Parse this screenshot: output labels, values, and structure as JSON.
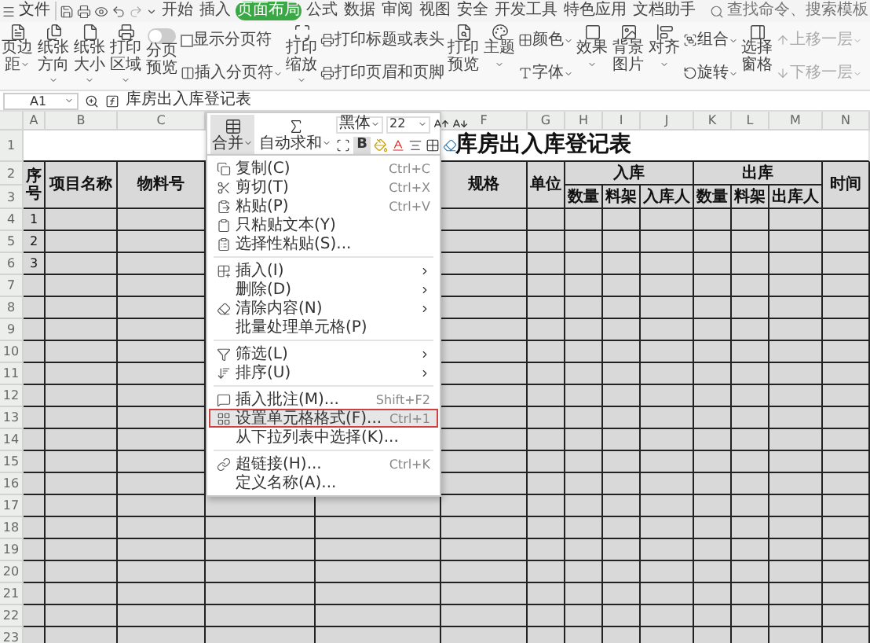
{
  "menu_button": {
    "label": "文件"
  },
  "tabs": [
    {
      "label": "开始",
      "selected": false
    },
    {
      "label": "插入",
      "selected": false
    },
    {
      "label": "页面布局",
      "selected": true
    },
    {
      "label": "公式",
      "selected": false
    },
    {
      "label": "数据",
      "selected": false
    },
    {
      "label": "审阅",
      "selected": false
    },
    {
      "label": "视图",
      "selected": false
    },
    {
      "label": "安全",
      "selected": false
    },
    {
      "label": "开发工具",
      "selected": false
    },
    {
      "label": "特色应用",
      "selected": false
    },
    {
      "label": "文档助手",
      "selected": false
    }
  ],
  "search": {
    "placeholder": "查找命令、搜索模板"
  },
  "ribbon": [
    {
      "kind": "large",
      "label": "页边距",
      "dropdown": true,
      "disabled": false
    },
    {
      "kind": "large",
      "label": "纸张方向",
      "dropdown": true,
      "disabled": false
    },
    {
      "kind": "large",
      "label": "纸张大小",
      "dropdown": true,
      "disabled": false
    },
    {
      "kind": "large",
      "label": "打印区域",
      "dropdown": true,
      "disabled": false
    },
    {
      "kind": "toggle",
      "label": "分页预览",
      "on": false
    },
    {
      "kind": "stack",
      "items": [
        {
          "kind": "checkbox",
          "label": "显示分页符",
          "checked": false
        },
        {
          "kind": "button",
          "label": "插入分页符",
          "dropdown": true,
          "disabled": false
        }
      ]
    },
    {
      "kind": "large",
      "label": "打印缩放",
      "dropdown": true,
      "disabled": false
    },
    {
      "kind": "stack",
      "items": [
        {
          "kind": "button",
          "label": "打印标题或表头",
          "dropdown": false,
          "disabled": false
        },
        {
          "kind": "button",
          "label": "打印页眉和页脚",
          "dropdown": false,
          "disabled": false
        }
      ]
    },
    {
      "kind": "large",
      "label": "打印预览",
      "dropdown": false,
      "disabled": false
    },
    {
      "kind": "large",
      "label": "主题",
      "dropdown": true,
      "disabled": false
    },
    {
      "kind": "stack",
      "items": [
        {
          "kind": "button",
          "label": "颜色",
          "dropdown": true,
          "disabled": false
        },
        {
          "kind": "button",
          "label": "字体",
          "dropdown": true,
          "disabled": false
        }
      ]
    },
    {
      "kind": "large",
      "label": "效果",
      "dropdown": true,
      "disabled": false
    },
    {
      "kind": "large",
      "label": "背景图片",
      "dropdown": false,
      "disabled": false
    },
    {
      "kind": "large",
      "label": "对齐",
      "dropdown": true,
      "disabled": false
    },
    {
      "kind": "stack",
      "items": [
        {
          "kind": "button",
          "label": "组合",
          "dropdown": true,
          "disabled": false
        },
        {
          "kind": "button",
          "label": "旋转",
          "dropdown": true,
          "disabled": false
        }
      ]
    },
    {
      "kind": "large",
      "label": "选择窗格",
      "dropdown": false,
      "disabled": false
    },
    {
      "kind": "stack",
      "items": [
        {
          "kind": "button",
          "label": "上移一层",
          "dropdown": true,
          "disabled": true
        },
        {
          "kind": "button",
          "label": "下移一层",
          "dropdown": true,
          "disabled": true
        }
      ]
    }
  ],
  "formula_bar": {
    "name_box": "A1",
    "formula": "库房出入库登记表"
  },
  "mini_toolbar": {
    "font": "黑体",
    "size": "22",
    "merge": "合并",
    "autosum": "自动求和",
    "bold": "B"
  },
  "sheet": {
    "column_headers": [
      {
        "label": "A"
      },
      {
        "label": "B"
      },
      {
        "label": "C"
      },
      {
        "label": "F"
      },
      {
        "label": "G"
      },
      {
        "label": "H"
      },
      {
        "label": "I"
      },
      {
        "label": "J"
      },
      {
        "label": "K"
      },
      {
        "label": "L"
      },
      {
        "label": "M"
      },
      {
        "label": "N"
      }
    ],
    "row_headers": [
      "1",
      "2",
      "3",
      "4",
      "5",
      "6",
      "7",
      "8",
      "9",
      "10",
      "11",
      "12",
      "13",
      "14",
      "15",
      "16",
      "17",
      "18",
      "19",
      "20",
      "21",
      "22",
      "23"
    ],
    "title": "库房出入库登记表",
    "headers": [
      {
        "label": "序号"
      },
      {
        "label": "项目名称"
      },
      {
        "label": "物料号"
      },
      {
        "label": "规格"
      },
      {
        "label": "单位"
      },
      {
        "label": "入库",
        "children": [
          "数量",
          "料架",
          "入库人"
        ]
      },
      {
        "label": "出库",
        "children": [
          "数量",
          "料架",
          "出库人"
        ]
      },
      {
        "label": "时间"
      }
    ],
    "rows": [
      {
        "number": "1"
      },
      {
        "number": "2"
      },
      {
        "number": "3"
      }
    ]
  },
  "context_menu": {
    "groups": [
      [
        {
          "label": "复制(C)",
          "shortcut": "Ctrl+C",
          "submenu": false,
          "selected": false
        },
        {
          "label": "剪切(T)",
          "shortcut": "Ctrl+X",
          "submenu": false,
          "selected": false
        },
        {
          "label": "粘贴(P)",
          "shortcut": "Ctrl+V",
          "submenu": false,
          "selected": false
        },
        {
          "label": "只粘贴文本(Y)",
          "submenu": false,
          "selected": false
        },
        {
          "label": "选择性粘贴(S)...",
          "submenu": false,
          "selected": false
        }
      ],
      [
        {
          "label": "插入(I)",
          "submenu": true,
          "selected": false
        },
        {
          "label": "删除(D)",
          "submenu": true,
          "selected": false
        },
        {
          "label": "清除内容(N)",
          "submenu": true,
          "selected": false
        },
        {
          "label": "批量处理单元格(P)",
          "submenu": false,
          "selected": false
        }
      ],
      [
        {
          "label": "筛选(L)",
          "submenu": true,
          "selected": false
        },
        {
          "label": "排序(U)",
          "submenu": true,
          "selected": false
        }
      ],
      [
        {
          "label": "插入批注(M)...",
          "shortcut": "Shift+F2",
          "submenu": false,
          "selected": false
        },
        {
          "label": "设置单元格格式(F)...",
          "shortcut": "Ctrl+1",
          "submenu": false,
          "selected": true
        },
        {
          "label": "从下拉列表中选择(K)...",
          "submenu": false,
          "selected": false
        }
      ],
      [
        {
          "label": "超链接(H)...",
          "shortcut": "Ctrl+K",
          "submenu": false,
          "selected": false
        },
        {
          "label": "定义名称(A)...",
          "submenu": false,
          "selected": false
        }
      ]
    ]
  }
}
